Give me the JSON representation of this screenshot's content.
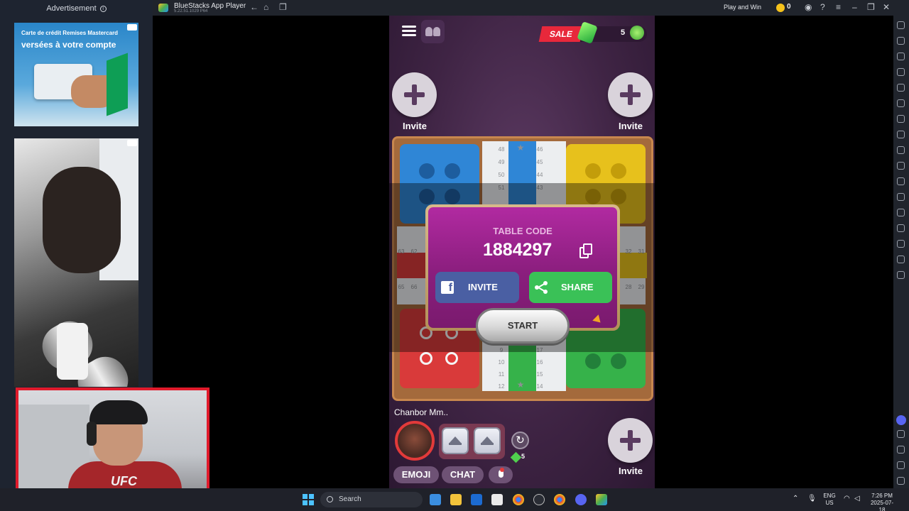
{
  "ads": {
    "header": "Advertisement",
    "ad1_line1": "Carte de crédit Remises Mastercard",
    "ad1_line2": "versées à votre compte"
  },
  "window": {
    "app_name": "BlueStacks App Player",
    "app_version": "5.22.51.1029 P64",
    "play_and_win": "Play and Win",
    "coin_count": "0"
  },
  "game": {
    "sale_label": "SALE",
    "clover_count": "5",
    "invite_label": "Invite",
    "board_numbers": {
      "top_left": [
        "48",
        "49",
        "50",
        "51"
      ],
      "top_right": [
        "46",
        "45",
        "44",
        "43"
      ],
      "left_top": [
        "63",
        "62"
      ],
      "left_bottom": [
        "65",
        "66"
      ],
      "right_top": [
        "32",
        "31"
      ],
      "right_bottom": [
        "28",
        "29"
      ],
      "bottom_left": [
        "9",
        "10",
        "11",
        "12"
      ],
      "bottom_right": [
        "17",
        "16",
        "15",
        "14"
      ]
    },
    "dialog": {
      "title": "TABLE CODE",
      "code": "1884297",
      "invite_button": "INVITE",
      "share_button": "SHARE",
      "start_button": "START"
    },
    "player_name": "Chanbor Mm..",
    "gem_count": "5",
    "emoji_button": "EMOJI",
    "chat_button": "CHAT"
  },
  "taskbar": {
    "search_placeholder": "Search",
    "lang_line1": "ENG",
    "lang_line2": "US",
    "time": "7:26 PM",
    "date": "2025-07-18"
  },
  "colors": {
    "blue_home": "#2f86d6",
    "yellow_home": "#e7c11c",
    "red_home": "#d93a3a",
    "green_home": "#36b24a",
    "dialog_bg": "#9a2390",
    "share_green": "#3ac157",
    "facebook_blue": "#4a5fa3",
    "sale_red": "#e8283b"
  }
}
